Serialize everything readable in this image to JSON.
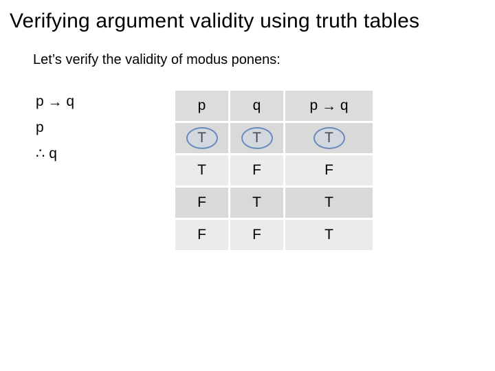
{
  "title": "Verifying argument validity using truth tables",
  "intro": "Let’s verify the validity of modus ponens:",
  "argument": {
    "line1_left": "p",
    "line1_arrow": "→",
    "line1_right": "q",
    "line2": "p",
    "line3_therefore": "∴",
    "line3_conc": "q"
  },
  "table": {
    "headers": {
      "p": "p",
      "q": "q",
      "pq_l": "p",
      "pq_arrow": "→",
      "pq_r": "q"
    },
    "rows": [
      {
        "p": "T",
        "q": "T",
        "pq": "T",
        "hl": true
      },
      {
        "p": "T",
        "q": "F",
        "pq": "F",
        "hl": false
      },
      {
        "p": "F",
        "q": "T",
        "pq": "T",
        "hl": false
      },
      {
        "p": "F",
        "q": "F",
        "pq": "T",
        "hl": false
      }
    ]
  },
  "chart_data": {
    "type": "table",
    "title": "Truth table for p → q (modus ponens verification)",
    "columns": [
      "p",
      "q",
      "p → q"
    ],
    "rows": [
      [
        "T",
        "T",
        "T"
      ],
      [
        "T",
        "F",
        "F"
      ],
      [
        "F",
        "T",
        "T"
      ],
      [
        "F",
        "F",
        "T"
      ]
    ],
    "highlighted_row_index": 0
  }
}
